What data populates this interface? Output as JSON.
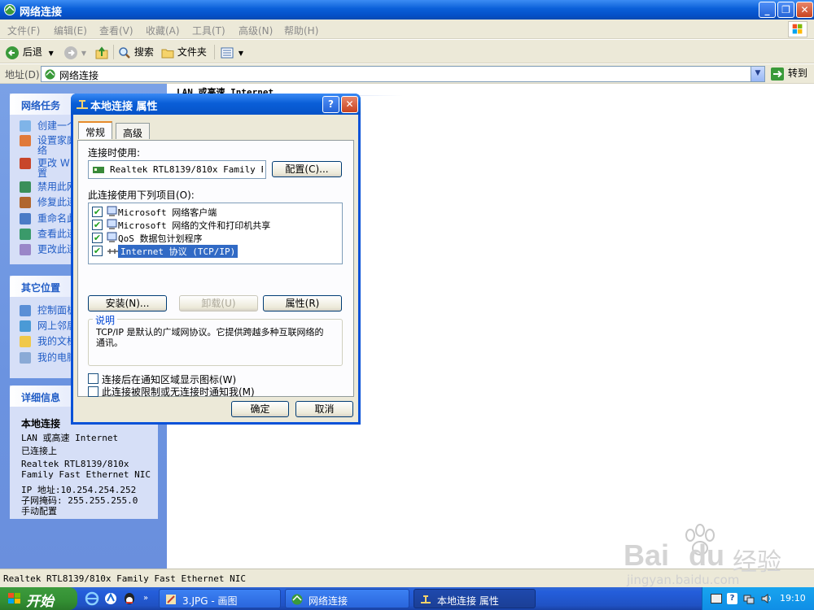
{
  "window": {
    "title": "网络连接",
    "caption_buttons": [
      "_",
      "❐",
      "✕"
    ]
  },
  "menu": [
    "文件(F)",
    "编辑(E)",
    "查看(V)",
    "收藏(A)",
    "工具(T)",
    "高级(N)",
    "帮助(H)"
  ],
  "toolbar": {
    "back": "后退",
    "search": "搜索",
    "folders": "文件夹"
  },
  "address": {
    "label": "地址(D)",
    "value": "网络连接",
    "go": "转到"
  },
  "tasks_panel": {
    "title": "网络任务",
    "items": [
      "创建一个",
      "设置家庭",
      "络",
      "更改 W",
      "置",
      "禁用此网",
      "修复此连",
      "重命名此",
      "查看此连",
      "更改此连"
    ]
  },
  "places_panel": {
    "title": "其它位置",
    "items": [
      "控制面板",
      "网上邻居",
      "我的文档",
      "我的电脑"
    ]
  },
  "details_panel": {
    "title": "详细信息",
    "name": "本地连接",
    "lines": [
      "LAN 或高速 Internet",
      "已连接上",
      "Realtek RTL8139/810x",
      "Family Fast Ethernet NIC",
      "IP 地址:10.254.254.252",
      "子网掩码: 255.255.255.0",
      "手动配置"
    ]
  },
  "content": {
    "category": "LAN 或高速 Internet"
  },
  "status_bar": "Realtek RTL8139/810x Family Fast Ethernet NIC",
  "dialog": {
    "title": "本地连接 属性",
    "help_btn": "?",
    "close_btn": "✕",
    "tabs": [
      "常规",
      "高级"
    ],
    "connect_using_label": "连接时使用:",
    "adapter": "Realtek RTL8139/810x Family Fa",
    "configure_btn": "配置(C)...",
    "items_label": "此连接使用下列项目(O):",
    "items": [
      {
        "label": "Microsoft 网络客户端",
        "checked": true
      },
      {
        "label": "Microsoft 网络的文件和打印机共享",
        "checked": true
      },
      {
        "label": "QoS 数据包计划程序",
        "checked": true
      },
      {
        "label": "Internet 协议 (TCP/IP)",
        "checked": true,
        "selected": true
      }
    ],
    "install_btn": "安装(N)...",
    "uninstall_btn": "卸载(U)",
    "properties_btn": "属性(R)",
    "description_title": "说明",
    "description": "TCP/IP 是默认的广域网协议。它提供跨越多种互联网络的通讯。",
    "option1": "连接后在通知区域显示图标(W)",
    "option2": "此连接被限制或无连接时通知我(M)",
    "ok_btn": "确定",
    "cancel_btn": "取消"
  },
  "taskbar": {
    "start": "开始",
    "tasks": [
      {
        "label": "3.JPG - 画图",
        "active": false
      },
      {
        "label": "网络连接",
        "active": false
      },
      {
        "label": "本地连接 属性",
        "active": true
      }
    ],
    "clock": "19:10"
  },
  "watermark": {
    "brand": "Bai",
    "brand2": "du",
    "cn": "经验",
    "url": "jingyan.baidu.com"
  }
}
